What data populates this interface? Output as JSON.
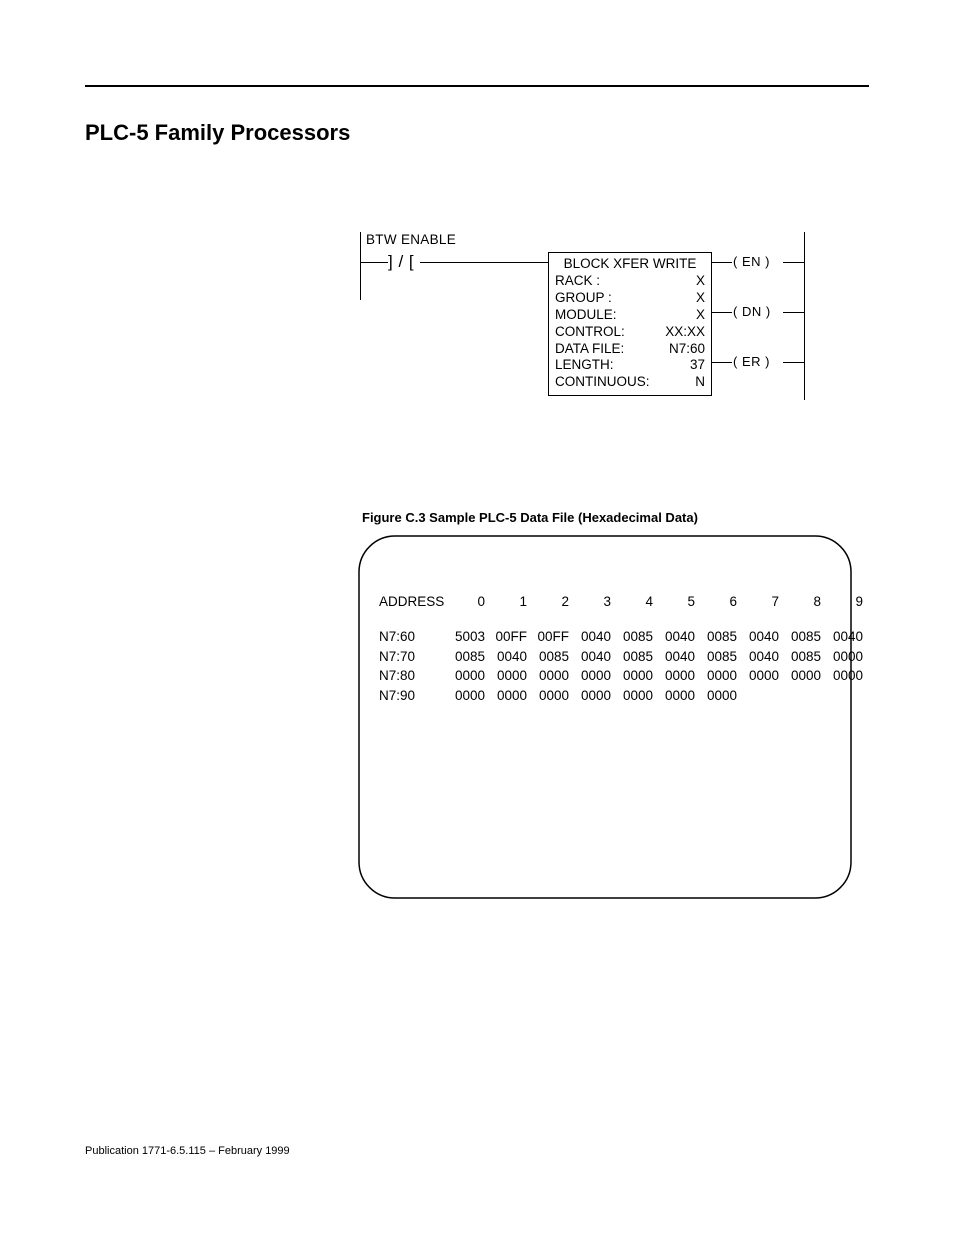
{
  "section_title": "PLC-5 Family Processors",
  "ladder": {
    "rung_label": "BTW ENABLE",
    "contact_glyph": "] / [",
    "instruction": {
      "title": "BLOCK XFER WRITE",
      "rows": [
        {
          "label": "RACK    :",
          "value": "X"
        },
        {
          "label": "GROUP  :",
          "value": "X"
        },
        {
          "label": "MODULE:",
          "value": "X"
        },
        {
          "label": "CONTROL:",
          "value": "XX:XX"
        },
        {
          "label": "DATA FILE:",
          "value": "N7:60"
        },
        {
          "label": "LENGTH:",
          "value": "37"
        },
        {
          "label": "CONTINUOUS:",
          "value": "N"
        }
      ]
    },
    "coils": {
      "en": "( EN )",
      "dn": "( DN )",
      "er": "( ER )"
    }
  },
  "figure_caption": "Figure C.3 Sample PLC-5 Data File (Hexadecimal Data)",
  "chart_data": {
    "type": "table",
    "title": "Sample PLC-5 Data File (Hexadecimal Data)",
    "header_label": "ADDRESS",
    "columns": [
      "0",
      "1",
      "2",
      "3",
      "4",
      "5",
      "6",
      "7",
      "8",
      "9"
    ],
    "rows": [
      {
        "address": "N7:60",
        "cells": [
          "5003",
          "00FF",
          "00FF",
          "0040",
          "0085",
          "0040",
          "0085",
          "0040",
          "0085",
          "0040"
        ]
      },
      {
        "address": "N7:70",
        "cells": [
          "0085",
          "0040",
          "0085",
          "0040",
          "0085",
          "0040",
          "0085",
          "0040",
          "0085",
          "0000"
        ]
      },
      {
        "address": "N7:80",
        "cells": [
          "0000",
          "0000",
          "0000",
          "0000",
          "0000",
          "0000",
          "0000",
          "0000",
          "0000",
          "0000"
        ]
      },
      {
        "address": "N7:90",
        "cells": [
          "0000",
          "0000",
          "0000",
          "0000",
          "0000",
          "0000",
          "0000",
          "",
          "",
          ""
        ]
      }
    ]
  },
  "footer": "Publication 1771-6.5.115 – February 1999"
}
